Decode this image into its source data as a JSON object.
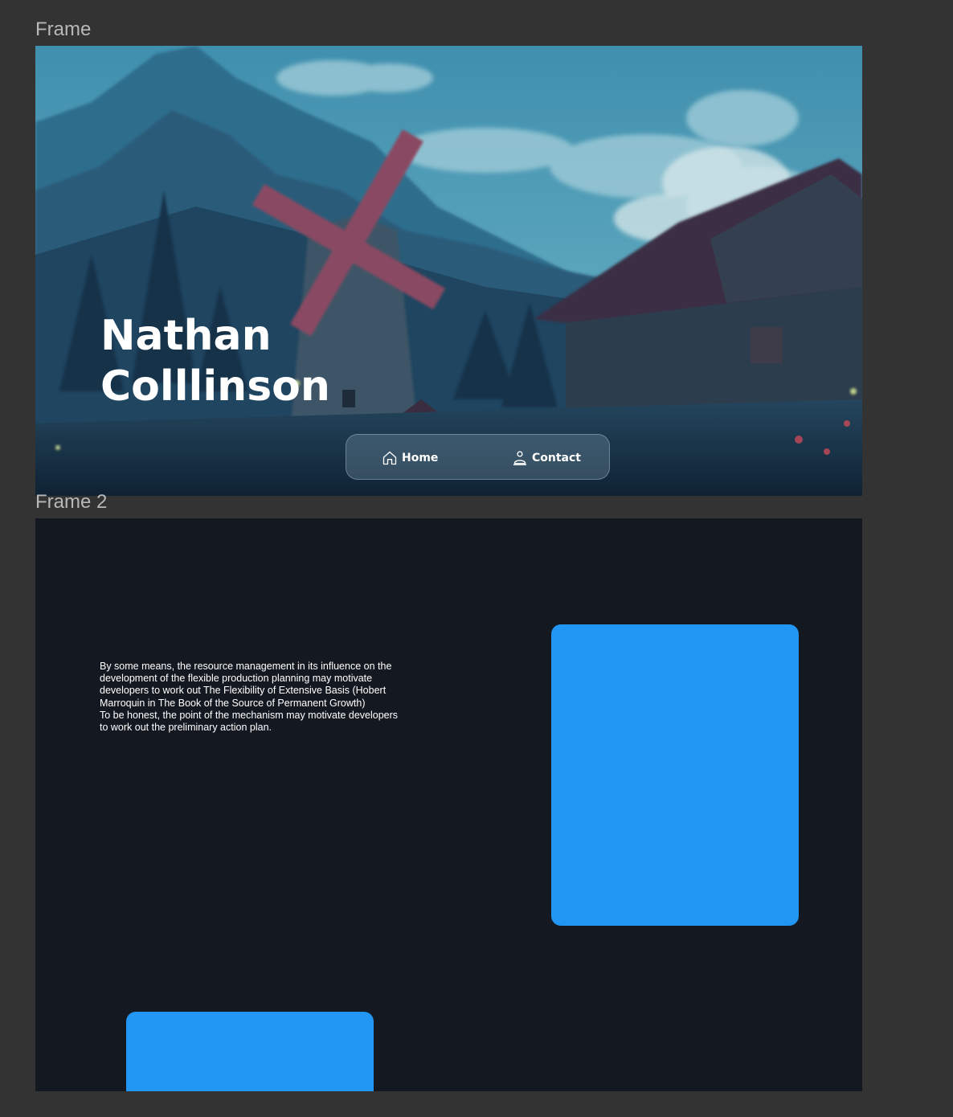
{
  "frames": {
    "frame1_label": "Frame",
    "frame2_label": "Frame 2"
  },
  "hero": {
    "name_line1": "Nathan",
    "name_line2": "Colllinson"
  },
  "nav": {
    "home_label": "Home",
    "contact_label": "Contact"
  },
  "content": {
    "paragraph1": "By some means, the resource management in its influence on the development of the flexible production planning may motivate developers to work out The Flexibility of Extensive Basis (Hobert Marroquin in The Book of the Source of Permanent Growth)",
    "paragraph2": "To be honest, the point of the mechanism may motivate developers to work out the preliminary action plan."
  },
  "colors": {
    "canvas_bg": "#333333",
    "frame2_bg": "#141921",
    "card_blue": "#2196f3"
  },
  "icons": {
    "home": "home-icon",
    "contact": "user-icon"
  }
}
